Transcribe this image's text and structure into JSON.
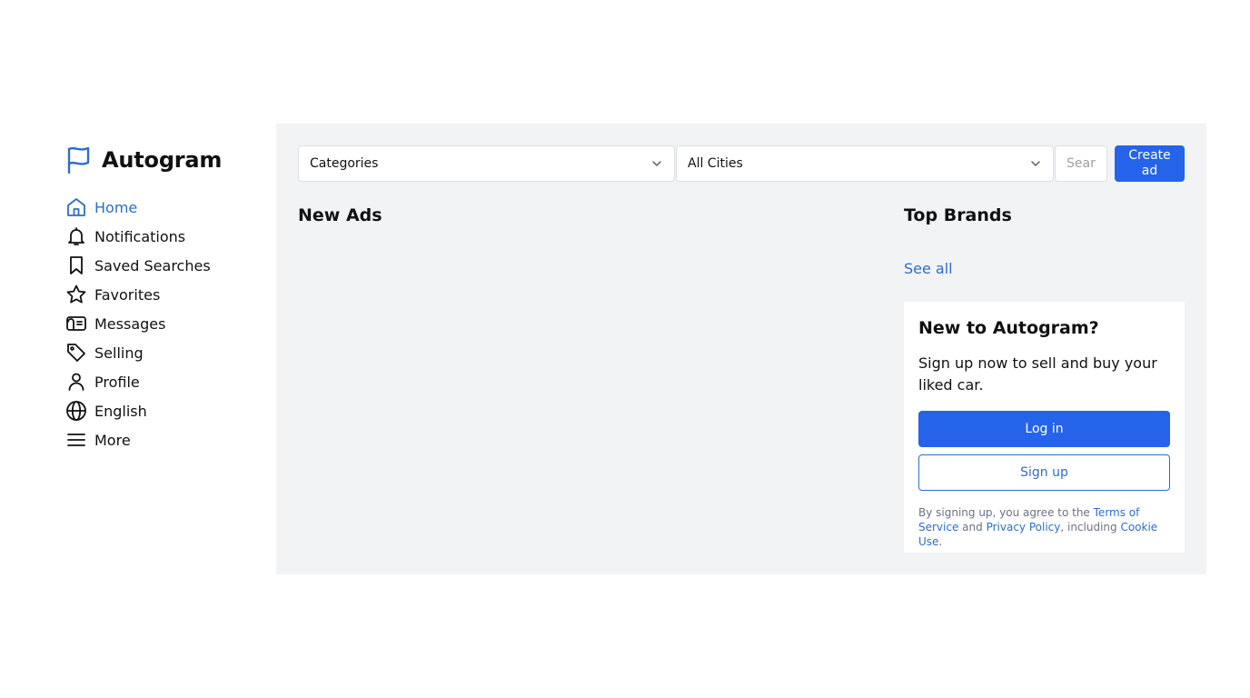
{
  "brand": {
    "name": "Autogram",
    "icon": "flag-icon",
    "color": "#2f6ec4"
  },
  "sidebar": {
    "items": [
      {
        "label": "Home",
        "icon": "home-icon",
        "active": true
      },
      {
        "label": "Notifications",
        "icon": "bell-icon"
      },
      {
        "label": "Saved Searches",
        "icon": "bookmark-icon"
      },
      {
        "label": "Favorites",
        "icon": "star-icon"
      },
      {
        "label": "Messages",
        "icon": "messages-icon"
      },
      {
        "label": "Selling",
        "icon": "tag-icon"
      },
      {
        "label": "Profile",
        "icon": "user-icon"
      },
      {
        "label": "English",
        "icon": "globe-icon"
      },
      {
        "label": "More",
        "icon": "menu-icon"
      }
    ]
  },
  "toolbar": {
    "categories_value": "Categories",
    "cities_value": "All Cities",
    "search_placeholder": "Search",
    "create_ad_label": "Create ad"
  },
  "main": {
    "new_ads_title": "New Ads",
    "top_brands_title": "Top Brands",
    "see_all_label": "See all"
  },
  "signup_card": {
    "title": "New to Autogram?",
    "text": "Sign up now to sell and buy your liked car.",
    "login_label": "Log in",
    "signup_label": "Sign up",
    "legal_prefix": "By signing up, you agree to the ",
    "terms_label": "Terms of Service",
    "legal_and": " and ",
    "privacy_label": "Privacy Policy",
    "legal_including": ", including ",
    "cookie_label": "Cookie Use",
    "legal_end": "."
  },
  "colors": {
    "accent": "#2563eb",
    "link": "#2f6ec4",
    "panel_bg": "#f2f3f5"
  }
}
